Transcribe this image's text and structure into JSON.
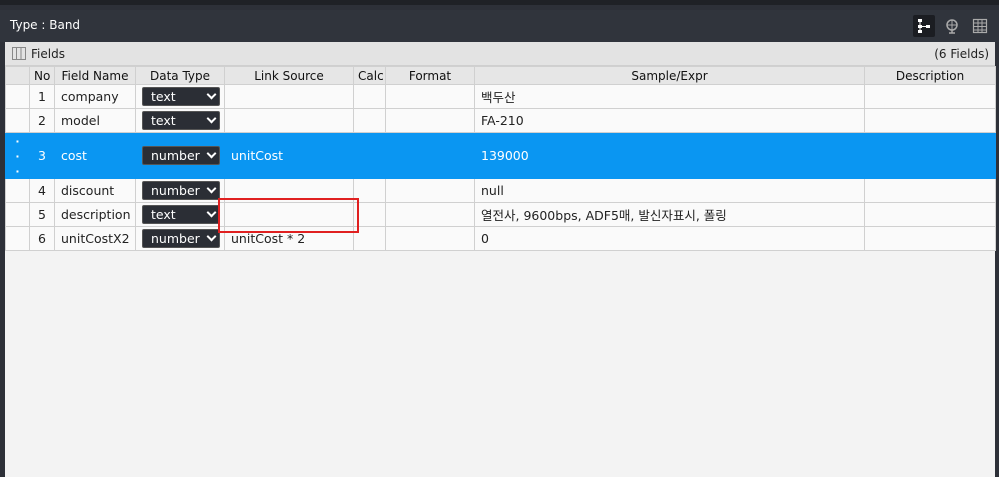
{
  "window": {
    "title": "Type : Band"
  },
  "toolbar": {
    "icons": [
      "tree-icon",
      "globe-icon",
      "table-icon"
    ]
  },
  "fields": {
    "label": "Fields",
    "count": "(6 Fields)"
  },
  "columns": {
    "no": "No",
    "field_name": "Field Name",
    "data_type": "Data Type",
    "link_source": "Link Source",
    "calc": "Calc",
    "format": "Format",
    "sample": "Sample/Expr",
    "description": "Description"
  },
  "rows": [
    {
      "no": "1",
      "name": "company",
      "type": "text",
      "link": "",
      "calc": "",
      "format": "",
      "sample": "백두산",
      "description": ""
    },
    {
      "no": "2",
      "name": "model",
      "type": "text",
      "link": "",
      "calc": "",
      "format": "",
      "sample": "FA-210",
      "description": ""
    },
    {
      "no": "3",
      "name": "cost",
      "type": "number",
      "link": "unitCost",
      "calc": "",
      "format": "",
      "sample": "139000",
      "description": ""
    },
    {
      "no": "4",
      "name": "discount",
      "type": "number",
      "link": "",
      "calc": "",
      "format": "",
      "sample": "null",
      "description": ""
    },
    {
      "no": "5",
      "name": "description",
      "type": "text",
      "link": "",
      "calc": "",
      "format": "",
      "sample": "열전사, 9600bps, ADF5매, 발신자표시, 폴링",
      "description": ""
    },
    {
      "no": "6",
      "name": "unitCostX2",
      "type": "number",
      "link": "unitCost * 2",
      "calc": "",
      "format": "",
      "sample": "0",
      "description": ""
    }
  ],
  "colors": {
    "selected": "#0a96f2",
    "highlight": "#e02020"
  }
}
